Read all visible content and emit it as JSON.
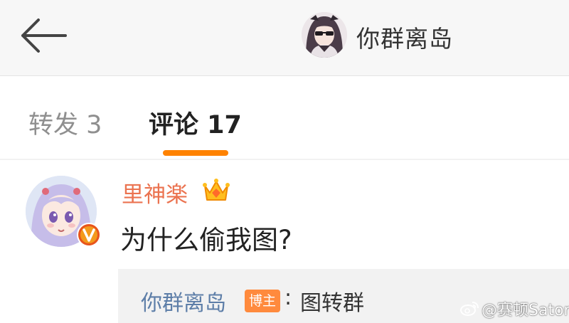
{
  "header": {
    "back_icon": "arrow-left-icon",
    "title": "你群离岛"
  },
  "tabs": [
    {
      "label": "转发 3",
      "active": false
    },
    {
      "label": "评论 17",
      "active": true
    }
  ],
  "colors": {
    "accent": "#ff8200",
    "commenter_name": "#eb7350",
    "reply_name": "#5d7ea8",
    "author_badge": "#ff8a3d",
    "verify_badge": "#e8541c"
  },
  "comment": {
    "username": "里神楽",
    "membership_icon": "crown-icon",
    "verify_icon": "verified-v-icon",
    "text": "为什么偷我图?",
    "reply": {
      "username": "你群离岛",
      "badge": "博主",
      "separator": ":",
      "text": "图转群"
    }
  },
  "watermark": {
    "icon": "weibo-icon",
    "text": "@赛顿Saton"
  }
}
